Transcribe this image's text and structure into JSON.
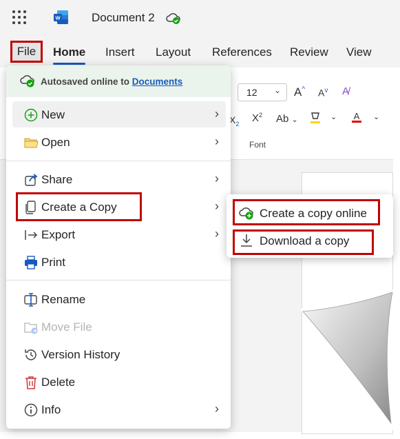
{
  "titlebar": {
    "app_launcher_icon": "waffle-grid-icon",
    "app_icon": "word-logo-icon",
    "doc_title": "Document 2",
    "save_status_icon": "cloud-check-icon"
  },
  "tabs": [
    {
      "label": "File"
    },
    {
      "label": "Home"
    },
    {
      "label": "Insert"
    },
    {
      "label": "Layout"
    },
    {
      "label": "References"
    },
    {
      "label": "Review"
    },
    {
      "label": "View"
    }
  ],
  "ribbon": {
    "font_size": "12",
    "group_font_label": "Font"
  },
  "file_menu": {
    "autosave_text": "Autosaved online to",
    "autosave_link": "Documents",
    "items": [
      {
        "label": "New",
        "icon": "plus-circle-icon",
        "submenu": true
      },
      {
        "label": "Open",
        "icon": "folder-icon",
        "submenu": true
      },
      {
        "label": "Share",
        "icon": "share-icon",
        "submenu": true
      },
      {
        "label": "Create a Copy",
        "icon": "copy-icon",
        "submenu": true
      },
      {
        "label": "Export",
        "icon": "export-icon",
        "submenu": true
      },
      {
        "label": "Print",
        "icon": "printer-icon",
        "submenu": false
      },
      {
        "label": "Rename",
        "icon": "rename-icon",
        "submenu": false
      },
      {
        "label": "Move File",
        "icon": "move-file-icon",
        "submenu": false,
        "disabled": true
      },
      {
        "label": "Version History",
        "icon": "history-icon",
        "submenu": false
      },
      {
        "label": "Delete",
        "icon": "trash-icon",
        "submenu": false
      },
      {
        "label": "Info",
        "icon": "info-icon",
        "submenu": true
      }
    ]
  },
  "copy_submenu": {
    "items": [
      {
        "label": "Create a copy online",
        "icon": "cloud-add-icon"
      },
      {
        "label": "Download a copy",
        "icon": "download-icon"
      }
    ]
  },
  "colors": {
    "highlight_box": "#c00000",
    "accent": "#185abd",
    "autosave_bg": "#ebf4ec"
  }
}
